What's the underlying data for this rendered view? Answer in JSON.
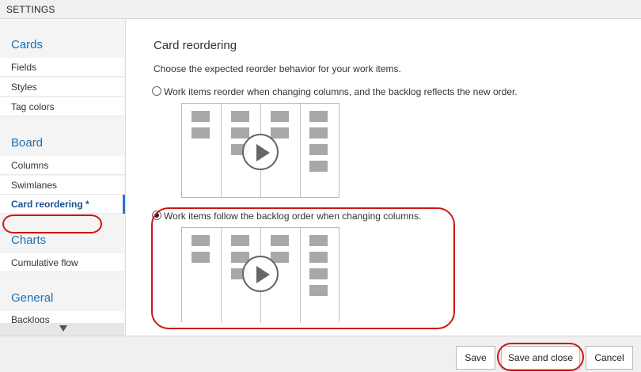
{
  "window": {
    "title": "SETTINGS"
  },
  "sidebar": {
    "sections": [
      {
        "header": "Cards",
        "items": [
          "Fields",
          "Styles",
          "Tag colors"
        ]
      },
      {
        "header": "Board",
        "items": [
          "Columns",
          "Swimlanes",
          "Card reordering *"
        ]
      },
      {
        "header": "Charts",
        "items": [
          "Cumulative flow"
        ]
      },
      {
        "header": "General",
        "items": [
          "Backlogs"
        ]
      }
    ],
    "selected_item": "Card reordering *"
  },
  "main": {
    "title": "Card reordering",
    "description": "Choose the expected reorder behavior for your work items.",
    "options": [
      {
        "label": "Work items reorder when changing columns, and the backlog reflects the new order.",
        "checked": false
      },
      {
        "label": "Work items follow the backlog order when changing columns.",
        "checked": true
      }
    ]
  },
  "footer": {
    "save_label": "Save",
    "save_close_label": "Save and close",
    "cancel_label": "Cancel"
  },
  "colors": {
    "accent": "#1e6eb0",
    "highlight_annotation": "#d01515",
    "card": "#a8a8a8"
  }
}
